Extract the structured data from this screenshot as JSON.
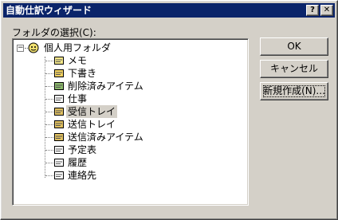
{
  "window": {
    "title": "自動仕訳ウィザード",
    "help_label": "?",
    "close_label": "✕"
  },
  "folder_label": "フォルダの選択(C):",
  "tree": {
    "root": {
      "label": "個人用フォルダ",
      "icon": "personal-folders-icon",
      "expander": "−"
    },
    "items": [
      {
        "label": "メモ",
        "icon": "notes-icon"
      },
      {
        "label": "下書き",
        "icon": "drafts-icon"
      },
      {
        "label": "削除済みアイテム",
        "icon": "deleted-items-icon"
      },
      {
        "label": "仕事",
        "icon": "tasks-icon"
      },
      {
        "label": "受信トレイ",
        "icon": "inbox-icon",
        "selected": true
      },
      {
        "label": "送信トレイ",
        "icon": "outbox-icon"
      },
      {
        "label": "送信済みアイテム",
        "icon": "sent-items-icon"
      },
      {
        "label": "予定表",
        "icon": "calendar-icon"
      },
      {
        "label": "履歴",
        "icon": "journal-icon"
      },
      {
        "label": "連絡先",
        "icon": "contacts-icon"
      }
    ]
  },
  "buttons": {
    "ok": "OK",
    "cancel": "キャンセル",
    "new": "新規作成(N)..."
  },
  "colors": {
    "titlebar": "#0a246a",
    "face": "#d4d0c8",
    "selection": "#d4d0c8"
  }
}
